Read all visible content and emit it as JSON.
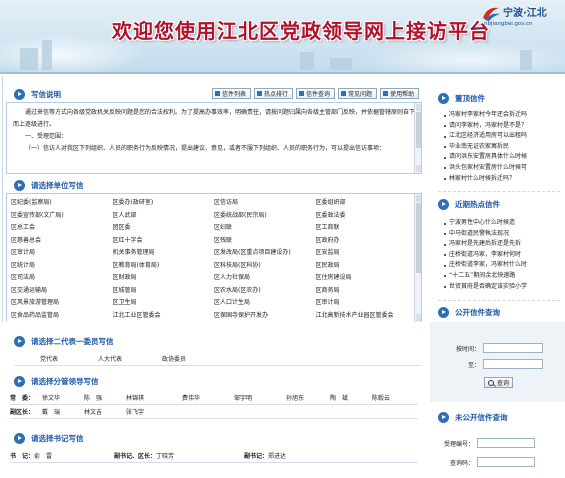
{
  "banner": {
    "title": "欢迎您使用江北区党政领导网上接访平台",
    "logo_text": "宁波·江北",
    "logo_sub": "nbjiangbei.gov.cn"
  },
  "instructions": {
    "heading": "写信说明",
    "tabs": [
      {
        "label": "信件列表"
      },
      {
        "label": "热点排行"
      },
      {
        "label": "信件查询"
      },
      {
        "label": "常见问题"
      },
      {
        "label": "使用帮助"
      }
    ],
    "paragraphs": [
      "通过来信等方式向各级党政机关反映问题是您的合法权利。为了提高办事效率，明确责任，请按问题归属向各级主管部门反映，并依据管辖原则自下而上逐级进行。",
      "一、受理范围：",
      "（一）信访人对我区下列组织、人员的职务行为反映情况，提出建议、意见，或者不服下列组织、人员的职务行为，可以提出信访事项："
    ]
  },
  "units": {
    "heading": "请选择单位写信",
    "items": [
      "区纪委(监察局)",
      "区委办(政研室)",
      "区信访局",
      "区委组织部",
      "区委宣传部(文广局)",
      "区人武部",
      "区委统战部(民宗局)",
      "区委政法委",
      "区总工会",
      "团区委",
      "区妇联",
      "区工商联",
      "区慈善总会",
      "区红十字会",
      "区残联",
      "区政府办",
      "区审计局",
      "机关事务管理局",
      "区发改局(区重点项目建设办)",
      "区安监局",
      "区统计局",
      "区教育局(体育局)",
      "区科技局(区科协)",
      "区民政局",
      "区司法局",
      "区财政局",
      "区人力社保局",
      "区住房建设局",
      "区交通运输局",
      "区城管局",
      "区农水局(区农办)",
      "区商务局",
      "区风景旅游管理局",
      "区卫生局",
      "区人口计生局",
      "区审计局",
      "区食品药品监管局",
      "江北工业区管委会",
      "区保国寺保护开发办",
      "江北高新技术产业园区管委会"
    ]
  },
  "two_reps": {
    "heading": "请选择二代表一委员写信",
    "items": [
      "党代表",
      "人大代表",
      "政协委员"
    ]
  },
  "leaders": {
    "heading": "请选择分管领导写信",
    "row1_label": "常　委：",
    "row1": [
      "徐文华",
      "陈　强",
      "林锦祺",
      "费伟华",
      "邹宇明",
      "孙旭东",
      "陶　斌",
      "陈毅云"
    ],
    "row2_label": "副区长：",
    "row2": [
      "戴　瑞",
      "林文吉",
      "张飞宇"
    ]
  },
  "secretary": {
    "heading": "请选择书记写信",
    "a_label": "书　记：",
    "a_name": "俞　雷",
    "b_label": "副书记、区长：",
    "b_name": "丁晓芳",
    "c_label": "副书记：",
    "c_name": "郑进达"
  },
  "recent": {
    "heading": "置顶信件",
    "items": [
      "冯家村李家村今年还会拆迁吗",
      "请问李家村，冯家村是不是？",
      "江北区经济适用房可以出租吗",
      "毕业南无证农家寓拆民",
      "请问洪东安置房具体什么时候",
      "洪头包家村安置房什么时候可",
      "林家村什么时候拆迁吗？"
    ]
  },
  "hot": {
    "heading": "近期热点信件",
    "items": [
      "宁波男性中心什么时候造",
      "中马街道民警執法现况",
      "冯家村是先建后拆还是先拆",
      "庄桥街道冯家，李家村何时",
      "庄桥街道李家，冯家村什么时",
      "“十二五”期间余北快速路",
      "世贸首府是否确定该实验小学"
    ]
  },
  "public_search": {
    "heading": "公开信件查询",
    "date_label": "按时间：",
    "to_label": "至：",
    "search_button": "查询"
  },
  "private_search": {
    "heading": "未公开信件查询",
    "accept_label": "受理编号：",
    "code_label": "查询码："
  }
}
